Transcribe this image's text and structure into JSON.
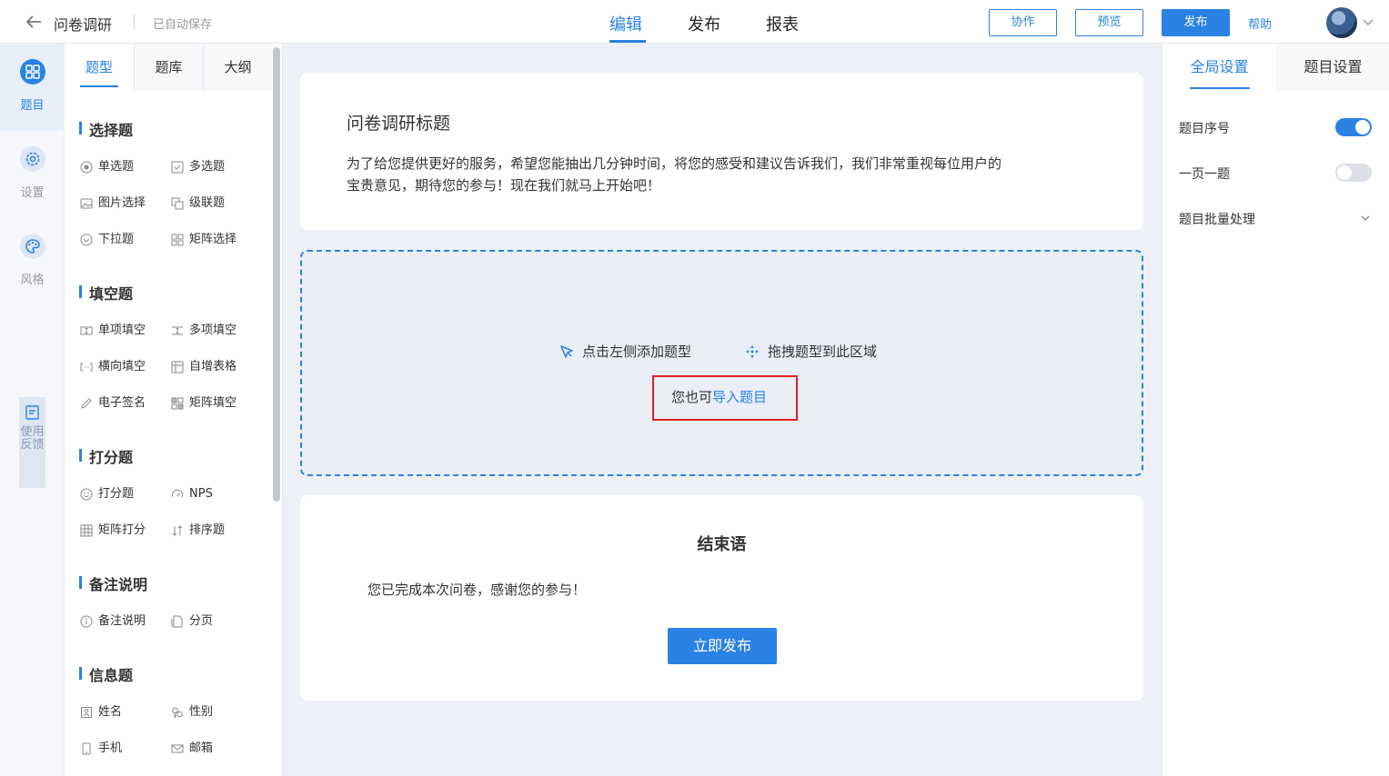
{
  "header": {
    "title": "问卷调研",
    "autosave": "已自动保存",
    "tabs": [
      {
        "label": "编辑",
        "active": true
      },
      {
        "label": "发布",
        "active": false
      },
      {
        "label": "报表",
        "active": false
      }
    ],
    "buttons": {
      "collab": "协作",
      "preview": "预览",
      "publish": "发布"
    },
    "help": "帮助",
    "accent_color": "#2a82e4"
  },
  "rail": {
    "items": [
      {
        "label": "题目",
        "icon": "grid-icon",
        "active": true
      },
      {
        "label": "设置",
        "icon": "gear-icon",
        "active": false
      },
      {
        "label": "风格",
        "icon": "palette-icon",
        "active": false
      }
    ],
    "feedback": "使用反馈"
  },
  "qpanel": {
    "tabs": [
      {
        "label": "题型",
        "active": true
      },
      {
        "label": "题库",
        "active": false
      },
      {
        "label": "大纲",
        "active": false
      }
    ],
    "sections": [
      {
        "title": "选择题",
        "items": [
          "单选题",
          "多选题",
          "图片选择",
          "级联题",
          "下拉题",
          "矩阵选择"
        ]
      },
      {
        "title": "填空题",
        "items": [
          "单项填空",
          "多项填空",
          "横向填空",
          "自增表格",
          "电子签名",
          "矩阵填空"
        ]
      },
      {
        "title": "打分题",
        "items": [
          "打分题",
          "NPS",
          "矩阵打分",
          "排序题"
        ]
      },
      {
        "title": "备注说明",
        "items": [
          "备注说明",
          "分页"
        ]
      },
      {
        "title": "信息题",
        "items": [
          "姓名",
          "性别",
          "手机",
          "邮箱"
        ]
      }
    ]
  },
  "canvas": {
    "survey_title": "问卷调研标题",
    "survey_desc": "为了给您提供更好的服务，希望您能抽出几分钟时间，将您的感受和建议告诉我们，我们非常重视每位用户的宝贵意见，期待您的参与！现在我们就马上开始吧！",
    "dropzone": {
      "hint_click": "点击左侧添加题型",
      "hint_drag": "拖拽题型到此区域",
      "import_prefix": "您也可",
      "import_link": "导入题目"
    },
    "ending": {
      "title": "结束语",
      "text": "您已完成本次问卷，感谢您的参与！",
      "button": "立即发布"
    }
  },
  "settings": {
    "tabs": [
      {
        "label": "全局设置",
        "active": true
      },
      {
        "label": "题目设置",
        "active": false
      }
    ],
    "items": [
      {
        "label": "题目序号",
        "toggle": true
      },
      {
        "label": "一页一题",
        "toggle": false
      },
      {
        "label": "题目批量处理"
      }
    ]
  }
}
